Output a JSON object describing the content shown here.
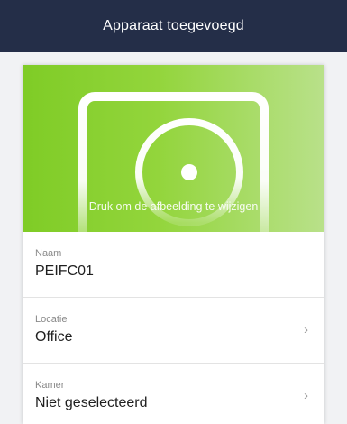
{
  "header": {
    "title": "Apparaat toegevoegd"
  },
  "hero": {
    "hint": "Druk om de afbeelding te wijzigen",
    "colors": {
      "gradient_start": "#7fcc26",
      "gradient_end": "#b9e18a",
      "device_outline": "#ffffff"
    }
  },
  "fields": [
    {
      "label": "Naam",
      "value": "PEIFC01"
    },
    {
      "label": "Locatie",
      "value": "Office",
      "chevron": "›"
    },
    {
      "label": "Kamer",
      "value": "Niet geselecteerd",
      "chevron": "›"
    }
  ],
  "theme": {
    "nav_background": "#242e48",
    "page_background": "#f1f2f4"
  }
}
